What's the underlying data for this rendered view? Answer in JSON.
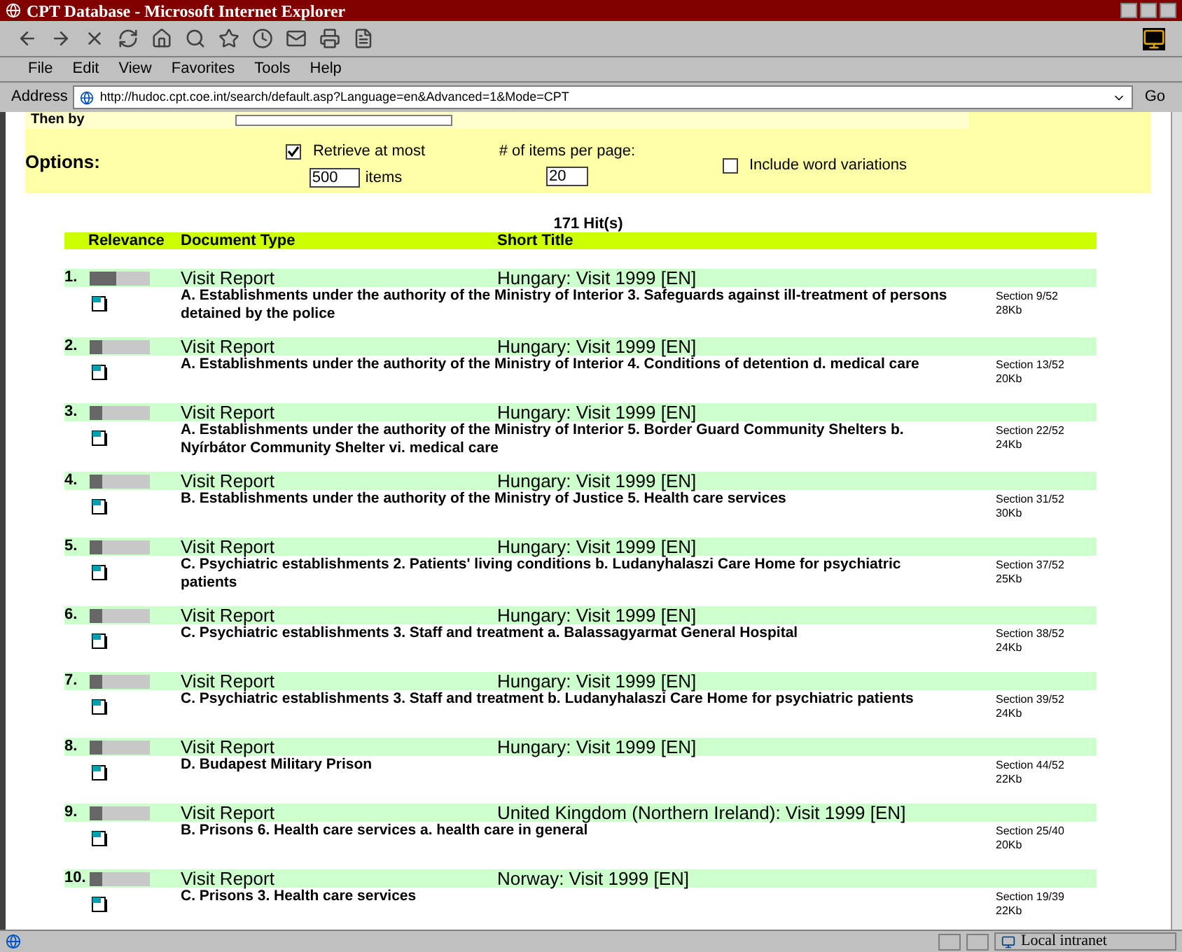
{
  "window": {
    "title": "CPT Database - Microsoft Internet Explorer"
  },
  "menu": [
    "File",
    "Edit",
    "View",
    "Favorites",
    "Tools",
    "Help"
  ],
  "address": {
    "label": "Address",
    "value": "http://hudoc.cpt.coe.int/search/default.asp?Language=en&Advanced=1&Mode=CPT",
    "go": "Go"
  },
  "form": {
    "then_by_label": "Then by",
    "options_label": "Options:",
    "retrieve": {
      "label": "Retrieve at most",
      "checked": true,
      "value": "500",
      "suffix": "items"
    },
    "per_page": {
      "label": "# of items per page:",
      "value": "20"
    },
    "word_variations": {
      "label": "Include word variations",
      "checked": false
    }
  },
  "hits": "171 Hit(s)",
  "columns": [
    "Relevance",
    "Document Type",
    "Short Title"
  ],
  "results": [
    {
      "number": "1.",
      "level": 0.45,
      "type": "Visit Report",
      "title": "Hungary: Visit 1999  [EN]",
      "description": "A. Establishments under the authority of the Ministry of Interior 3. Safeguards against ill-treatment of persons detained by the police",
      "section": "Section 9/52",
      "size": "28Kb"
    },
    {
      "number": "2.",
      "level": 0.22,
      "type": "Visit Report",
      "title": "Hungary: Visit 1999  [EN]",
      "description": "A. Establishments under the authority of the Ministry of Interior 4. Conditions of detention d. medical care",
      "section": "Section 13/52",
      "size": "20Kb"
    },
    {
      "number": "3.",
      "level": 0.22,
      "type": "Visit Report",
      "title": "Hungary: Visit 1999  [EN]",
      "description": "A. Establishments under the authority of the Ministry of Interior 5. Border Guard Community Shelters b. Nyírbátor Community Shelter vi. medical care",
      "section": "Section 22/52",
      "size": "24Kb"
    },
    {
      "number": "4.",
      "level": 0.22,
      "type": "Visit Report",
      "title": "Hungary: Visit 1999  [EN]",
      "description": "B. Establishments under the authority of the Ministry of Justice 5. Health care services",
      "section": "Section 31/52",
      "size": "30Kb"
    },
    {
      "number": "5.",
      "level": 0.22,
      "type": "Visit Report",
      "title": "Hungary: Visit 1999  [EN]",
      "description": "C. Psychiatric establishments 2. Patients' living conditions b. Ludanyhalaszi Care Home for psychiatric patients",
      "section": "Section 37/52",
      "size": "25Kb"
    },
    {
      "number": "6.",
      "level": 0.22,
      "type": "Visit Report",
      "title": "Hungary: Visit 1999  [EN]",
      "description": "C. Psychiatric establishments 3. Staff and treatment a. Balassagyarmat General Hospital",
      "section": "Section 38/52",
      "size": "24Kb"
    },
    {
      "number": "7.",
      "level": 0.22,
      "type": "Visit Report",
      "title": "Hungary: Visit 1999  [EN]",
      "description": "C. Psychiatric establishments 3. Staff and treatment b. Ludanyhalaszi Care Home for psychiatric patients",
      "section": "Section 39/52",
      "size": "24Kb"
    },
    {
      "number": "8.",
      "level": 0.22,
      "type": "Visit Report",
      "title": "Hungary: Visit 1999  [EN]",
      "description": "D. Budapest Military Prison",
      "section": "Section 44/52",
      "size": "22Kb"
    },
    {
      "number": "9.",
      "level": 0.22,
      "type": "Visit Report",
      "title": "United Kingdom (Northern Ireland): Visit 1999  [EN]",
      "description": "B. Prisons 6. Health care services a. health care in general",
      "section": "Section 25/40",
      "size": "20Kb"
    },
    {
      "number": "10.",
      "level": 0.22,
      "type": "Visit Report",
      "title": "Norway: Visit 1999  [EN]",
      "description": "C. Prisons 3. Health care services",
      "section": "Section 19/39",
      "size": "22Kb"
    }
  ],
  "status_bar": {
    "zone": "Local intranet"
  }
}
